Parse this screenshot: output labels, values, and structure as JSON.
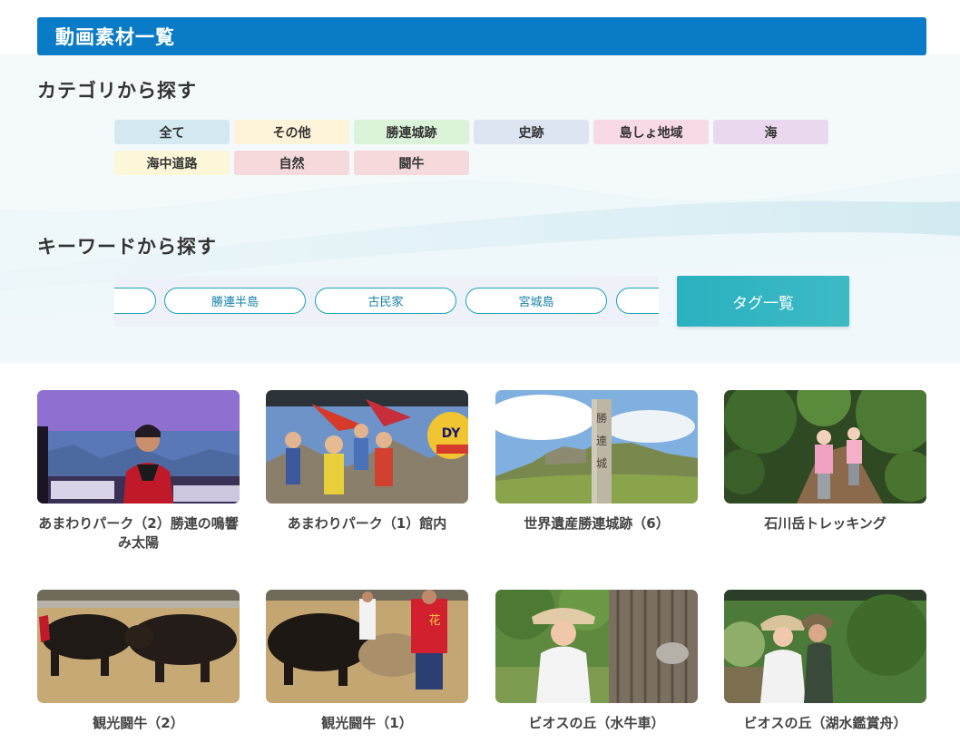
{
  "page": {
    "title": "動画素材一覧"
  },
  "category_section": {
    "heading": "カテゴリから探す",
    "items": [
      {
        "label": "全て",
        "color": "#d4e9f2"
      },
      {
        "label": "その他",
        "color": "#fdf3d9"
      },
      {
        "label": "勝連城跡",
        "color": "#dbf3d8"
      },
      {
        "label": "史跡",
        "color": "#dde4f2"
      },
      {
        "label": "島しょ地域",
        "color": "#f8d9e6"
      },
      {
        "label": "海",
        "color": "#ead9ee"
      },
      {
        "label": "海中道路",
        "color": "#fbf7d7"
      },
      {
        "label": "自然",
        "color": "#f6d9da"
      },
      {
        "label": "闘牛",
        "color": "#f6d9da"
      }
    ]
  },
  "keyword_section": {
    "heading": "キーワードから探す",
    "tags": [
      "",
      "勝連半島",
      "古民家",
      "宮城島",
      ""
    ],
    "tag_list_button": "タグ一覧"
  },
  "videos": [
    {
      "title": "あまわりパーク（2）勝連の鳴響み太陽"
    },
    {
      "title": "あまわりパーク（1）館内"
    },
    {
      "title": "世界遺産勝連城跡（6）"
    },
    {
      "title": "石川岳トレッキング"
    },
    {
      "title": "観光闘牛（2）"
    },
    {
      "title": "観光闘牛（1）"
    },
    {
      "title": "ビオスの丘（水牛車）"
    },
    {
      "title": "ビオスの丘（湖水鑑賞舟）"
    }
  ],
  "colors": {
    "title_bar": "#0a7bc6",
    "tag_border": "#1aa3b8",
    "tag_list_button": "#2ab1c0"
  }
}
